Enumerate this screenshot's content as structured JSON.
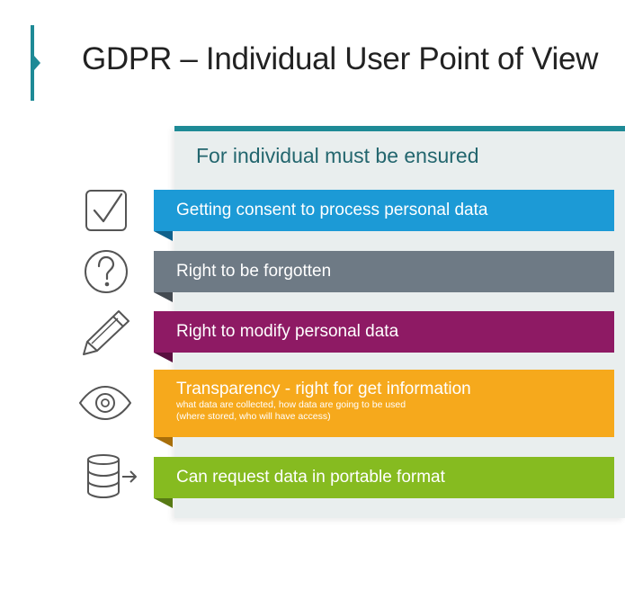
{
  "slide": {
    "title": "GDPR – Individual User Point of View",
    "panel_heading": "For individual must be ensured",
    "colors": {
      "accent": "#1e8a96",
      "panel": "#e9eeee",
      "consent": "#1c9ad6",
      "forgotten": "#6e7a85",
      "modify": "#8e1a64",
      "transparency": "#f6a91c",
      "portable": "#86bb20"
    },
    "items": [
      {
        "icon": "checkbox-icon",
        "label": "Getting consent to process personal data"
      },
      {
        "icon": "question-icon",
        "label": "Right to be forgotten"
      },
      {
        "icon": "pencil-icon",
        "label": "Right to modify personal data"
      },
      {
        "icon": "eye-icon",
        "label": "Transparency - right for get information",
        "sub_line1": "what data are collected, how data are going to be used",
        "sub_line2": "(where stored, who will have access)"
      },
      {
        "icon": "database-export-icon",
        "label": "Can request data in portable format"
      }
    ]
  }
}
